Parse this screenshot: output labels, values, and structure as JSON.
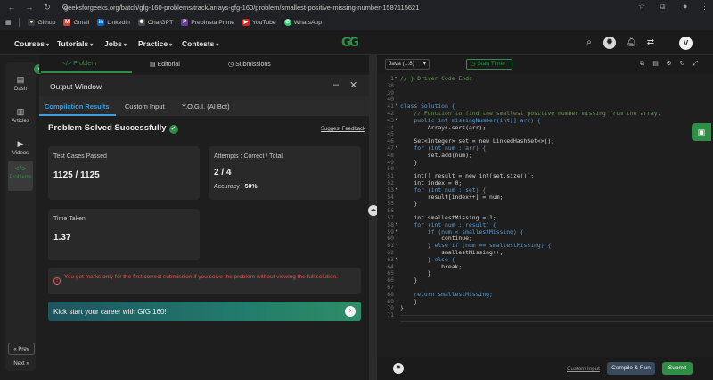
{
  "browser": {
    "url": "geeksforgeeks.org/batch/gfg-160-problems/track/arrays-gfg-160/problem/smallest-positive-missing-number-1587115621",
    "bookmarks": [
      {
        "label": "Github",
        "icon": "github-icon",
        "color": "#3a3a3a"
      },
      {
        "label": "Gmail",
        "icon": "gmail-icon",
        "color": "#d44638"
      },
      {
        "label": "LinkedIn",
        "icon": "linkedin-icon",
        "color": "#0a66c2"
      },
      {
        "label": "ChatGPT",
        "icon": "chatgpt-icon",
        "color": "#4a4a4a"
      },
      {
        "label": "PrepInsta Prime",
        "icon": "prepinsta-icon",
        "color": "#6b3fa0"
      },
      {
        "label": "YouTube",
        "icon": "youtube-icon",
        "color": "#e62117"
      },
      {
        "label": "WhatsApp",
        "icon": "whatsapp-icon",
        "color": "#25d366"
      }
    ]
  },
  "site": {
    "menu": [
      "Courses",
      "Tutorials",
      "Jobs",
      "Practice",
      "Contests"
    ],
    "logo": "GG",
    "avatar": "V",
    "accent": "#2f8d46"
  },
  "rail": {
    "items": [
      {
        "label": "Dash",
        "icon": "dashboard-icon"
      },
      {
        "label": "Articles",
        "icon": "articles-icon"
      },
      {
        "label": "Videos",
        "icon": "videos-icon"
      },
      {
        "label": "Problems",
        "icon": "code-icon"
      }
    ],
    "prev": "« Prev",
    "next": "Next »"
  },
  "left_tabs": [
    "Problem",
    "Editorial",
    "Submissions"
  ],
  "output": {
    "title": "Output Window",
    "tabs": [
      "Compilation Results",
      "Custom Input",
      "Y.O.G.I. (AI Bot)"
    ],
    "status": "Problem Solved Successfully",
    "feedback": "Suggest Feedback",
    "test_cases_label": "Test Cases Passed",
    "test_cases_value": "1125 / 1125",
    "attempts_label": "Attempts : Correct / Total",
    "attempts_value": "2 / 4",
    "accuracy_label": "Accuracy :",
    "accuracy_value": "50%",
    "time_label": "Time Taken",
    "time_value": "1.37",
    "warning": "You get marks only for the first correct submission if you solve the problem without viewing the full solution.",
    "banner": "Kick start your career with GfG 160!"
  },
  "editor": {
    "language": "Java (1.8)",
    "timer": "Start Timer",
    "lines": [
      {
        "n": "1",
        "t": "// } Driver Code Ends",
        "c": "cm",
        "fold": "▸"
      },
      {
        "n": "38",
        "t": "",
        "c": ""
      },
      {
        "n": "39",
        "t": "",
        "c": ""
      },
      {
        "n": "40",
        "t": "",
        "c": ""
      },
      {
        "n": "41",
        "t": "class Solution {",
        "c": "kw",
        "fold": "▾"
      },
      {
        "n": "42",
        "t": "    // Function to find the smallest positive number missing from the array.",
        "c": "cm"
      },
      {
        "n": "43",
        "t": "    public int missingNumber(int[] arr) {",
        "c": "kw",
        "fold": "▾"
      },
      {
        "n": "44",
        "t": "        Arrays.sort(arr);",
        "c": ""
      },
      {
        "n": "45",
        "t": "",
        "c": ""
      },
      {
        "n": "46",
        "t": "    Set<Integer> set = new LinkedHashSet<>();",
        "c": ""
      },
      {
        "n": "47",
        "t": "    for (int num : arr) {",
        "c": "kw",
        "fold": "▾"
      },
      {
        "n": "48",
        "t": "        set.add(num);",
        "c": ""
      },
      {
        "n": "49",
        "t": "    }",
        "c": ""
      },
      {
        "n": "50",
        "t": "",
        "c": ""
      },
      {
        "n": "51",
        "t": "    int[] result = new int[set.size()];",
        "c": ""
      },
      {
        "n": "52",
        "t": "    int index = 0;",
        "c": ""
      },
      {
        "n": "53",
        "t": "    for (int num : set) {",
        "c": "kw",
        "fold": "▾"
      },
      {
        "n": "54",
        "t": "        result[index++] = num;",
        "c": ""
      },
      {
        "n": "55",
        "t": "    }",
        "c": ""
      },
      {
        "n": "56",
        "t": "",
        "c": ""
      },
      {
        "n": "57",
        "t": "    int smallestMissing = 1;",
        "c": ""
      },
      {
        "n": "58",
        "t": "    for (int num : result) {",
        "c": "kw",
        "fold": "▾"
      },
      {
        "n": "59",
        "t": "        if (num < smallestMissing) {",
        "c": "kw",
        "fold": "▾"
      },
      {
        "n": "60",
        "t": "            continue;",
        "c": ""
      },
      {
        "n": "61",
        "t": "        } else if (num == smallestMissing) {",
        "c": "kw",
        "fold": "▾"
      },
      {
        "n": "62",
        "t": "            smallestMissing++;",
        "c": ""
      },
      {
        "n": "63",
        "t": "        } else {",
        "c": "kw",
        "fold": "▾"
      },
      {
        "n": "64",
        "t": "            break;",
        "c": ""
      },
      {
        "n": "65",
        "t": "        }",
        "c": ""
      },
      {
        "n": "66",
        "t": "    }",
        "c": ""
      },
      {
        "n": "67",
        "t": "",
        "c": ""
      },
      {
        "n": "68",
        "t": "    return smallestMissing;",
        "c": "kw"
      },
      {
        "n": "69",
        "t": "    }",
        "c": ""
      },
      {
        "n": "70",
        "t": "}",
        "c": ""
      },
      {
        "n": "71",
        "t": "",
        "c": ""
      }
    ],
    "custom_input": "Custom Input",
    "run": "Compile & Run",
    "submit": "Submit"
  }
}
